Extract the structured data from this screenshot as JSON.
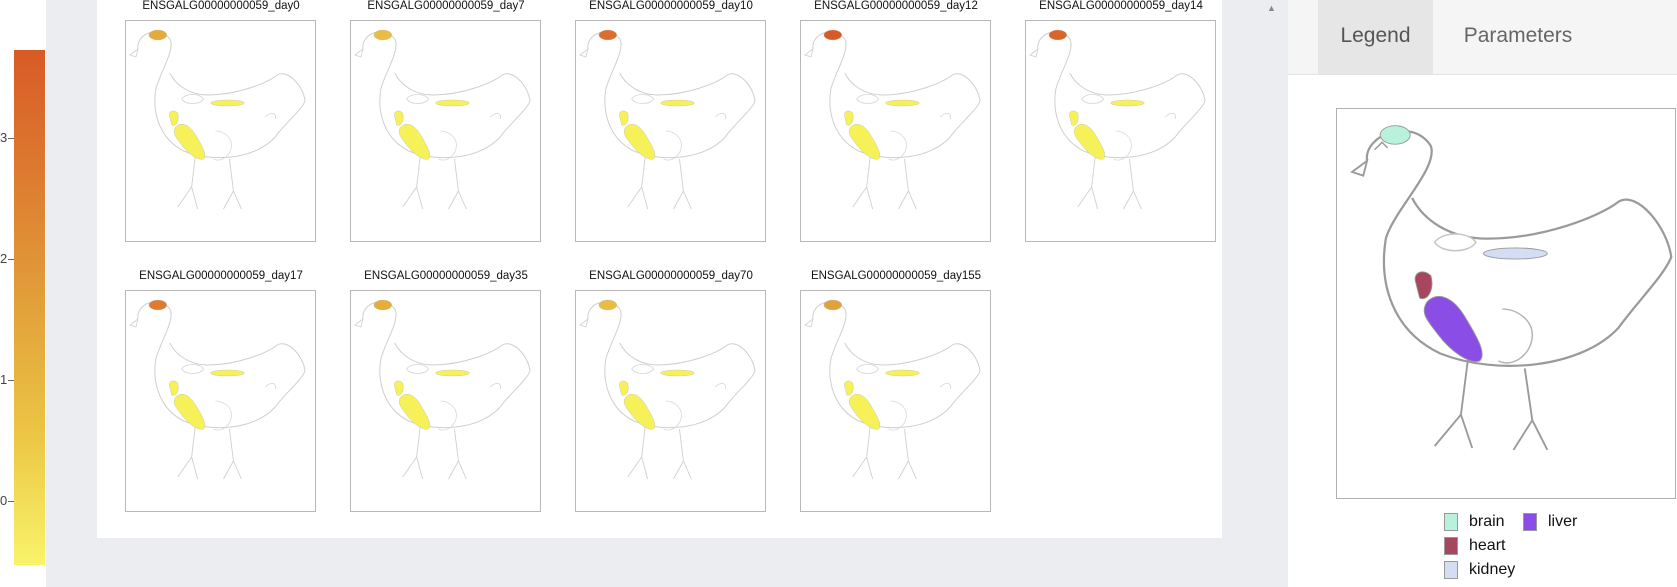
{
  "colorbar": {
    "ticks": [
      "3",
      "2",
      "1",
      "0"
    ],
    "gradient_colors": [
      "#d85a26",
      "#e2a13a",
      "#f8f46a"
    ]
  },
  "panels": [
    {
      "title": "ENSGALG00000000059_day0",
      "brain_color": "#e5aa37"
    },
    {
      "title": "ENSGALG00000000059_day7",
      "brain_color": "#e8bd40"
    },
    {
      "title": "ENSGALG00000000059_day10",
      "brain_color": "#dc6d2b"
    },
    {
      "title": "ENSGALG00000000059_day12",
      "brain_color": "#d85a26"
    },
    {
      "title": "ENSGALG00000000059_day14",
      "brain_color": "#da6529"
    },
    {
      "title": "ENSGALG00000000059_day17",
      "brain_color": "#dd7c30"
    },
    {
      "title": "ENSGALG00000000059_day35",
      "brain_color": "#e5ad3a"
    },
    {
      "title": "ENSGALG00000000059_day70",
      "brain_color": "#e8bd40"
    },
    {
      "title": "ENSGALG00000000059_day155",
      "brain_color": "#e2a13a"
    }
  ],
  "default_tissue_color": "#f7f159",
  "tabs": [
    "Legend",
    "Parameters"
  ],
  "active_tab": "Legend",
  "legend": [
    {
      "label": "brain",
      "color": "#b8f2dc"
    },
    {
      "label": "heart",
      "color": "#a6465f"
    },
    {
      "label": "kidney",
      "color": "#d3ddf3"
    },
    {
      "label": "liver",
      "color": "#8a4de6"
    }
  ]
}
